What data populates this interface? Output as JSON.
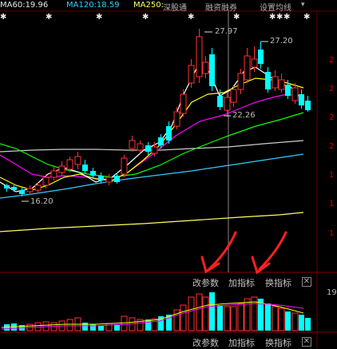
{
  "topbar": {
    "ma60": "MA60:19.96",
    "ma120": "MA120:18.59",
    "ma250": "MA250:",
    "link1": "深股通",
    "link2": "融资融券",
    "link3": "设置均线",
    "caret": "▾"
  },
  "price_labels": {
    "high1": "27.97",
    "high2": "27.20",
    "low1": "22.26",
    "low2": "16.20"
  },
  "right_axis_labels": [
    "2",
    "2",
    "2",
    "2",
    "1",
    "1",
    "1"
  ],
  "volume_axis_label": "19",
  "panel_controls_1": [
    "改参数",
    "加指标",
    "换指标"
  ],
  "panel_controls_2": [
    "改参数",
    "加指标",
    "换指标"
  ],
  "close_symbol": "✕",
  "event_marker": "✱",
  "colors": {
    "up": "#ff3232",
    "down": "#00ffff",
    "ma5": "#ffffff",
    "ma10": "#ffff00",
    "ma20": "#ff00ff",
    "ma30": "#00ff00",
    "ma60": "#cccccc",
    "ma120": "#33ccff",
    "ma250": "#ffff66",
    "annotation": "#ff2020"
  }
}
